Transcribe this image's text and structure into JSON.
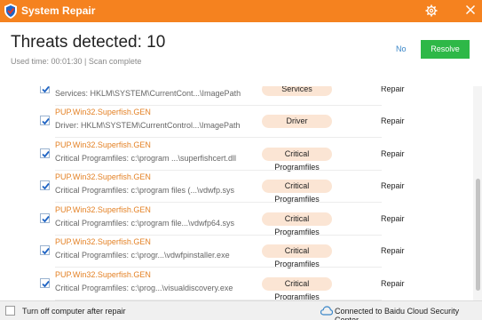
{
  "window": {
    "title": "System Repair"
  },
  "header": {
    "title": "Threats detected: 10",
    "subtitle": "Used time: 00:01:30 | Scan complete",
    "no_label": "No",
    "resolve_label": "Resolve"
  },
  "rows": [
    {
      "name": "",
      "path": "Services: HKLM\\SYSTEM\\CurrentCont...\\ImagePath",
      "category": "Services",
      "action": "Repair",
      "checked": true
    },
    {
      "name": "PUP.Win32.Superfish.GEN",
      "path": "Driver: HKLM\\SYSTEM\\CurrentControl...\\ImagePath",
      "category": "Driver",
      "action": "Repair",
      "checked": true
    },
    {
      "name": "PUP.Win32.Superfish.GEN",
      "path": "Critical Programfiles: c:\\program ...\\superfishcert.dll",
      "category": "Critical Programfiles",
      "action": "Repair",
      "checked": true
    },
    {
      "name": "PUP.Win32.Superfish.GEN",
      "path": "Critical Programfiles: c:\\program files (...\\vdwfp.sys",
      "category": "Critical Programfiles",
      "action": "Repair",
      "checked": true
    },
    {
      "name": "PUP.Win32.Superfish.GEN",
      "path": "Critical Programfiles: c:\\program file...\\vdwfp64.sys",
      "category": "Critical Programfiles",
      "action": "Repair",
      "checked": true
    },
    {
      "name": "PUP.Win32.Superfish.GEN",
      "path": "Critical Programfiles: c:\\progr...\\vdwfpinstaller.exe",
      "category": "Critical Programfiles",
      "action": "Repair",
      "checked": true
    },
    {
      "name": "PUP.Win32.Superfish.GEN",
      "path": "Critical Programfiles: c:\\prog...\\visualdiscovery.exe",
      "category": "Critical Programfiles",
      "action": "Repair",
      "checked": true
    }
  ],
  "footer": {
    "shutdown_label": "Turn off computer after repair",
    "status": "Connected to Baidu Cloud Security Center"
  },
  "colors": {
    "accent": "#f5821f",
    "resolve": "#2eb847",
    "threat_name": "#e48226",
    "badge_bg": "#fbe5d4"
  }
}
